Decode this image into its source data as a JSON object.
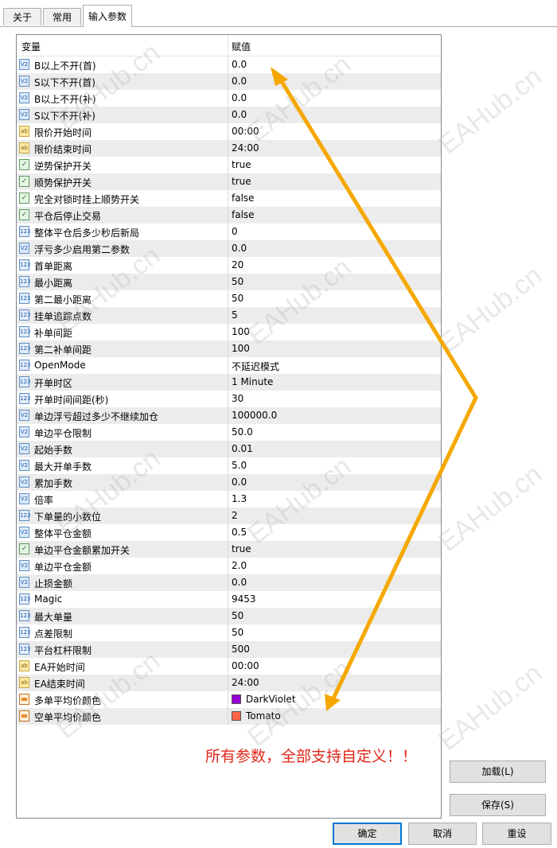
{
  "tabs": [
    "关于",
    "常用",
    "输入参数"
  ],
  "active_tab_index": 2,
  "table": {
    "header": {
      "variable": "变量",
      "value": "赋值"
    },
    "rows": [
      {
        "icon": "v2",
        "name": "B以上不开(首)",
        "value": "0.0"
      },
      {
        "icon": "v2",
        "name": "S以下不开(首)",
        "value": "0.0"
      },
      {
        "icon": "v2",
        "name": "B以上不开(补)",
        "value": "0.0"
      },
      {
        "icon": "v2",
        "name": "S以下不开(补)",
        "value": "0.0"
      },
      {
        "icon": "ab",
        "name": "限价开始时间",
        "value": "00:00"
      },
      {
        "icon": "ab",
        "name": "限价结束时间",
        "value": "24:00"
      },
      {
        "icon": "bool",
        "name": "逆势保护开关",
        "value": "true"
      },
      {
        "icon": "bool",
        "name": "顺势保护开关",
        "value": "true"
      },
      {
        "icon": "bool",
        "name": "完全对锁时挂上顺势开关",
        "value": "false"
      },
      {
        "icon": "bool",
        "name": "平仓后停止交易",
        "value": "false"
      },
      {
        "icon": "n123",
        "name": "整体平仓后多少秒后新局",
        "value": "0"
      },
      {
        "icon": "v2",
        "name": "浮亏多少启用第二参数",
        "value": "0.0"
      },
      {
        "icon": "n123",
        "name": "首单距离",
        "value": "20"
      },
      {
        "icon": "n123",
        "name": "最小距离",
        "value": "50"
      },
      {
        "icon": "n123",
        "name": "第二最小距离",
        "value": "50"
      },
      {
        "icon": "n123",
        "name": "挂单追踪点数",
        "value": "5"
      },
      {
        "icon": "n123",
        "name": "补单间距",
        "value": "100"
      },
      {
        "icon": "n123",
        "name": "第二补单间距",
        "value": "100"
      },
      {
        "icon": "n123",
        "name": "OpenMode",
        "value": "不延迟模式"
      },
      {
        "icon": "n123",
        "name": "开单时区",
        "value": "1 Minute"
      },
      {
        "icon": "n123",
        "name": "开单时间间距(秒)",
        "value": "30"
      },
      {
        "icon": "v2",
        "name": "单边浮亏超过多少不继续加仓",
        "value": "100000.0"
      },
      {
        "icon": "v2",
        "name": "单边平仓限制",
        "value": "50.0"
      },
      {
        "icon": "v2",
        "name": "起始手数",
        "value": "0.01"
      },
      {
        "icon": "v2",
        "name": "最大开单手数",
        "value": "5.0"
      },
      {
        "icon": "v2",
        "name": "累加手数",
        "value": "0.0"
      },
      {
        "icon": "v2",
        "name": "倍率",
        "value": "1.3"
      },
      {
        "icon": "n123",
        "name": "下单量的小数位",
        "value": "2"
      },
      {
        "icon": "v2",
        "name": "整体平仓金额",
        "value": "0.5"
      },
      {
        "icon": "bool",
        "name": "单边平仓金额累加开关",
        "value": "true"
      },
      {
        "icon": "v2",
        "name": "单边平仓金额",
        "value": "2.0"
      },
      {
        "icon": "v2",
        "name": "止损金额",
        "value": "0.0"
      },
      {
        "icon": "n123",
        "name": "Magic",
        "value": "9453"
      },
      {
        "icon": "n123",
        "name": "最大单量",
        "value": "50"
      },
      {
        "icon": "n123",
        "name": "点差限制",
        "value": "50"
      },
      {
        "icon": "n123",
        "name": "平台杠杆限制",
        "value": "500"
      },
      {
        "icon": "ab",
        "name": "EA开始时间",
        "value": "00:00"
      },
      {
        "icon": "ab",
        "name": "EA结束时间",
        "value": "24:00"
      },
      {
        "icon": "clr",
        "name": "多单平均价颜色",
        "value": "DarkViolet",
        "swatch": "#9400d3"
      },
      {
        "icon": "clr",
        "name": "空单平均价颜色",
        "value": "Tomato",
        "swatch": "#ff6347"
      }
    ]
  },
  "annotation_text": "所有参数，全部支持自定义！！",
  "watermark_text": "EAHub.cn",
  "buttons": {
    "load": "加载(L)",
    "save": "保存(S)",
    "ok": "确定",
    "cancel": "取消",
    "reset": "重设"
  },
  "colors": {
    "arrow": "#f5a800",
    "annotation": "#e0261a",
    "focus_border": "#0078d7"
  }
}
